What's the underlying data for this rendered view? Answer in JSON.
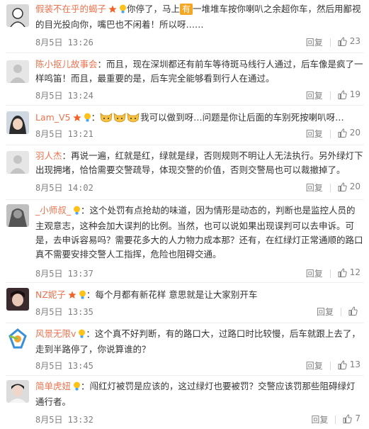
{
  "reply_label": "回复",
  "comments": [
    {
      "user": "假装不在乎的蝎子",
      "badges": [
        "star",
        "bulb"
      ],
      "pre": "你停了，马上",
      "highlight": "有",
      "text": "一堆堆车按你喇叭之余超你车，然后用鄙视的目光投向你，嘴巴也不闲着！所以呀……",
      "time": "8月5日 13:26",
      "likes": "23"
    },
    {
      "user": "陈小抠儿故事会",
      "badges": [],
      "text": "：而且，现在深圳都还有前车等待斑马线行人通过，后车像是疯了一样鸣笛！而且，最重要的是，后车完全能够看到行人在通过。",
      "time": "8月5日 13:24",
      "likes": "19"
    },
    {
      "user": "Lam_V5",
      "badges": [
        "star",
        "bulb"
      ],
      "pre": "：",
      "emojis": 3,
      "text": "我可以做到呀…问题是你让后面的车别死按喇叭呀…",
      "time": "8月5日 13:21",
      "likes": "20"
    },
    {
      "user": "羽人杰",
      "badges": [],
      "text": "：再说一遍，红就是红，绿就是绿，否则规则不明让人无法执行。另外绿灯下出现拥堵，恰恰需要交警疏导，体现交警的价值，否则交警局也可以裁撤掉了。",
      "time": "8月5日 14:02",
      "likes": "20"
    },
    {
      "user": "_小师叔_",
      "badges": [
        "bulb"
      ],
      "text": "：这个处罚有点抢劫的味道，因为情形是动态的，判断也是监控人员的主观意志，这种会加大误判的比例。当然，也可以说如果出现误判可以去申诉。可是，去申诉容易吗？需要花多大的人力物力成本那？还有，在红绿灯正常通顺的路口真不需要安排交警人工指挥，危险也阻碍交通。",
      "time": "8月5日 13:37",
      "likes": "12"
    },
    {
      "user": "NZ妮子",
      "badges": [
        "star",
        "bulb"
      ],
      "text": "：每个月都有新花样 意思就是让大家别开车",
      "time": "8月5日 13:35",
      "likes": ""
    },
    {
      "user": "风景无限v",
      "badges": [
        "bulb"
      ],
      "text": "：这个真不好判断，有的路口大，过路口时比较慢，后车就跟上去了，走到半路停了，你说算谁的？",
      "time": "8月5日 13:45",
      "likes": "13"
    },
    {
      "user": "简单虎妞",
      "badges": [
        "bulb"
      ],
      "text": "：闯红灯被罚是应该的，这过绿灯也要被罚？交警应该罚那些阻碍绿灯通行者。",
      "time": "8月5日 13:32",
      "likes": "7"
    }
  ],
  "colors": {
    "username": "#eb7350",
    "text": "#333333",
    "meta": "#808080",
    "highlight": "#f5a623"
  }
}
